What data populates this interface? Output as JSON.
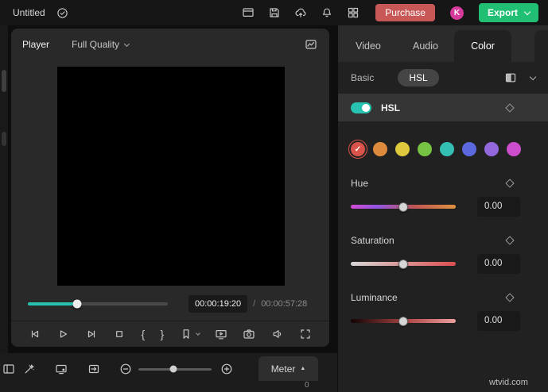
{
  "app": {
    "title": "Untitled",
    "watermark": "wtvid.com"
  },
  "topbar": {
    "purchase_label": "Purchase",
    "avatar_initial": "K",
    "export_label": "Export"
  },
  "player": {
    "panel_title": "Player",
    "quality_label": "Full Quality",
    "current_time": "00:00:19:20",
    "time_separator": "/",
    "total_time": "00:00:57:28",
    "progress_width": "35%",
    "accent_color": "#27c2b0"
  },
  "glyphs": {
    "mark_in": "{",
    "mark_out": "}",
    "check": "✓",
    "meter_caret": "▲"
  },
  "toolbar": {
    "meter_label": "Meter",
    "zoom_slider_pos": "48%",
    "meter_scale_zero": "0"
  },
  "right_panel": {
    "tabs": [
      {
        "label": "Video"
      },
      {
        "label": "Audio"
      },
      {
        "label": "Color"
      }
    ],
    "active_tab": "Color",
    "subtabs": [
      {
        "label": "Basic"
      },
      {
        "label": "HSL"
      }
    ],
    "active_subtab": "HSL",
    "hsl": {
      "title": "HSL",
      "enabled": true,
      "toggle_color": "#27c2b0",
      "swatches": [
        {
          "name": "red",
          "color": "#d9534a",
          "selected": true
        },
        {
          "name": "orange",
          "color": "#dd8a3c",
          "selected": false
        },
        {
          "name": "yellow",
          "color": "#ddc83e",
          "selected": false
        },
        {
          "name": "green",
          "color": "#77c344",
          "selected": false
        },
        {
          "name": "teal",
          "color": "#33bfb1",
          "selected": false
        },
        {
          "name": "blue",
          "color": "#5c68dd",
          "selected": false
        },
        {
          "name": "purple",
          "color": "#9468dd",
          "selected": false
        },
        {
          "name": "magenta",
          "color": "#cc4ecc",
          "selected": false
        }
      ],
      "controls": [
        {
          "label": "Hue",
          "value": "0.00",
          "handle_pos": "50%",
          "gradient": "linear-gradient(90deg, #d24bd2 0%, #9156e2 25%, #bf5555 60%, #e0923f 100%)"
        },
        {
          "label": "Saturation",
          "value": "0.00",
          "handle_pos": "50%",
          "gradient": "linear-gradient(90deg, #d8d8d8 0%, #dd4f4f 100%)"
        },
        {
          "label": "Luminance",
          "value": "0.00",
          "handle_pos": "50%",
          "gradient": "linear-gradient(90deg, #120303 0%, #b04848 55%, #eda0a0 100%)"
        }
      ]
    }
  }
}
